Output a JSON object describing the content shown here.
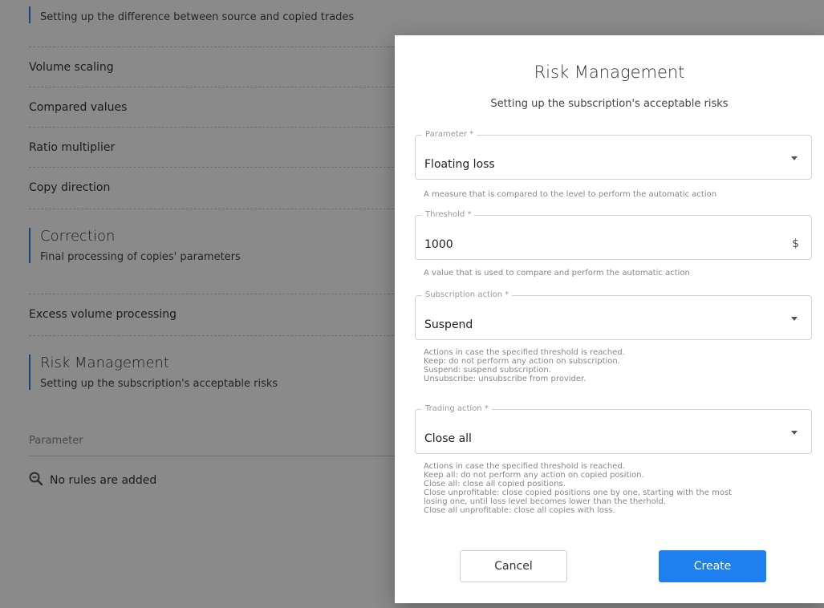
{
  "background": {
    "sections": [
      {
        "title": "",
        "subtitle": "Setting up the difference between source and copied trades"
      },
      {
        "title": "Correction",
        "subtitle": "Final processing of copies' parameters"
      },
      {
        "title": "Risk Management",
        "subtitle": "Setting up the subscription's acceptable risks"
      }
    ],
    "rows": [
      "Volume scaling",
      "Compared values",
      "Ratio multiplier",
      "Copy direction",
      "Excess volume processing"
    ],
    "table": {
      "column_header": "Parameter",
      "empty_text": "No rules are added",
      "empty_icon": "zoom-out-icon"
    }
  },
  "modal": {
    "title": "Risk Management",
    "subtitle": "Setting up the subscription's acceptable risks",
    "fields": [
      {
        "label": "Parameter *",
        "value": "Floating loss",
        "type": "select",
        "help": "A measure that is compared to the level to perform the automatic action"
      },
      {
        "label": "Threshold *",
        "value": "1000",
        "unit": "$",
        "type": "input",
        "help": "A value that is used to compare and perform the automatic action"
      },
      {
        "label": "Subscription action *",
        "value": "Suspend",
        "type": "select",
        "help": "Actions in case the specified threshold is reached.\nKeep: do not perform any action on subscription.\nSuspend: suspend subscription.\nUnsubscribe: unsubscribe from provider."
      },
      {
        "label": "Trading action *",
        "value": "Close all",
        "type": "select",
        "help": "Actions in case the specified threshold is reached.\nKeep all: do not perform any action on copied position.\nClose all: close all copied positions.\nClose unprofitable: close copied positions one by one, starting with the most\nlosing one, until loss level becomes lower than the therhold.\nClose all unprofitable: close all copies with loss."
      }
    ],
    "buttons": {
      "cancel": "Cancel",
      "create": "Create"
    },
    "colors": {
      "primary": "#1e80ef",
      "accent": "#2f7fd8"
    }
  }
}
